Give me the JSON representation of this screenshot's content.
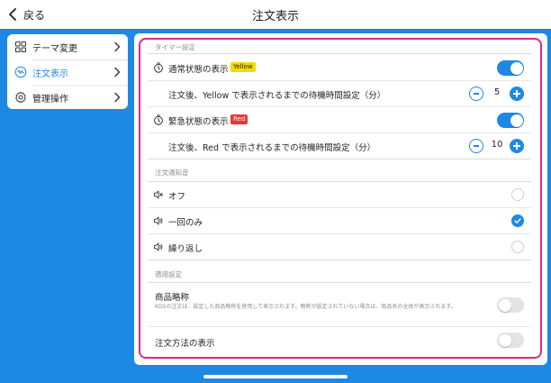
{
  "header": {
    "back_label": "戻る",
    "title": "注文表示"
  },
  "sidebar": {
    "items": [
      {
        "label": "テーマ変更",
        "icon": "grid-icon",
        "active": false
      },
      {
        "label": "注文表示",
        "icon": "order-display-icon",
        "active": true
      },
      {
        "label": "管理操作",
        "icon": "gear-icon",
        "active": false
      }
    ]
  },
  "timer": {
    "section_label": "タイマー設定",
    "normal": {
      "label": "通常状態の表示",
      "badge": "Yellow",
      "enabled": true,
      "wait_label": "注文後、Yellow で表示されるまでの待機時間設定（分）",
      "minutes": "5"
    },
    "urgent": {
      "label": "緊急状態の表示",
      "badge": "Red",
      "enabled": true,
      "wait_label": "注文後、Red で表示されるまでの待機時間設定（分）",
      "minutes": "10"
    }
  },
  "sound": {
    "section_label": "注文通知音",
    "options": [
      {
        "label": "オフ",
        "icon": "speaker-mute-icon",
        "selected": false
      },
      {
        "label": "一回のみ",
        "icon": "speaker-icon",
        "selected": true
      },
      {
        "label": "繰り返し",
        "icon": "speaker-icon",
        "selected": false
      }
    ]
  },
  "apply": {
    "section_label": "適用設定",
    "short_name": {
      "label": "商品略称",
      "description": "KDSの注文は、設定した商品略称を使用して表示されます。略称が設定されていない場合は、商品名の全体が表示されます。",
      "enabled": false
    },
    "method": {
      "label": "注文方法の表示",
      "enabled": false
    }
  },
  "colors": {
    "accent": "#1e88e5",
    "highlight_border": "#e3267c",
    "yellow_badge": "#f5d90a",
    "red_badge": "#e53935"
  }
}
